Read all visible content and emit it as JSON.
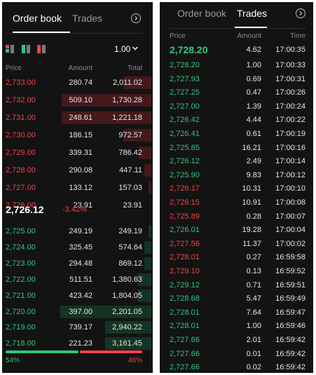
{
  "colors": {
    "buy": "#2fc77a",
    "sell": "#f0424a",
    "background": "#131313"
  },
  "left": {
    "tabs": [
      {
        "label": "Order book",
        "active": true
      },
      {
        "label": "Trades",
        "active": false
      }
    ],
    "forward_icon": "chevron-right-circle-icon",
    "aggregation": "1.00",
    "headers": {
      "price": "Price",
      "amount": "Amount",
      "total": "Total"
    },
    "asks": [
      {
        "price": "2,733.00",
        "amount": "280.74",
        "total": "2,011.02",
        "depth": 0.2
      },
      {
        "price": "2,732.00",
        "amount": "509.10",
        "total": "1,730.28",
        "depth": 0.64
      },
      {
        "price": "2,731.00",
        "amount": "248.61",
        "total": "1,221.18",
        "depth": 0.64
      },
      {
        "price": "2,730.00",
        "amount": "186.15",
        "total": "972.57",
        "depth": 0.2
      },
      {
        "price": "2,729.00",
        "amount": "339.31",
        "total": "786.42",
        "depth": 0.09
      },
      {
        "price": "2,728.00",
        "amount": "290.08",
        "total": "447.11",
        "depth": 0.05
      },
      {
        "price": "2,727.00",
        "amount": "133.12",
        "total": "157.03",
        "depth": 0.02
      },
      {
        "price": "2,726.00",
        "amount": "23.91",
        "total": "23.91",
        "depth": 0.0
      }
    ],
    "last_price": "2,726.12",
    "change": "-3.42%",
    "bids": [
      {
        "price": "2,725.00",
        "amount": "249.19",
        "total": "249.19",
        "depth": 0.02
      },
      {
        "price": "2,724.00",
        "amount": "325.45",
        "total": "574.64",
        "depth": 0.05
      },
      {
        "price": "2,723.00",
        "amount": "294.48",
        "total": "869.12",
        "depth": 0.05
      },
      {
        "price": "2,722.00",
        "amount": "511.51",
        "total": "1,380.63",
        "depth": 0.1
      },
      {
        "price": "2,721.00",
        "amount": "423.42",
        "total": "1,804.05",
        "depth": 0.1
      },
      {
        "price": "2,720.00",
        "amount": "397.00",
        "total": "2,201.05",
        "depth": 0.65
      },
      {
        "price": "2,719.00",
        "amount": "739.17",
        "total": "2,940.22",
        "depth": 0.33
      },
      {
        "price": "2,718.00",
        "amount": "221.23",
        "total": "3,161.45",
        "depth": 0.33
      }
    ],
    "buy_ratio": {
      "label": "54%",
      "value": 54
    },
    "sell_ratio": {
      "label": "46%",
      "value": 46
    }
  },
  "right": {
    "tabs": [
      {
        "label": "Order book",
        "active": false
      },
      {
        "label": "Trades",
        "active": true
      }
    ],
    "forward_icon": "chevron-right-circle-icon",
    "headers": {
      "price": "Price",
      "amount": "Amount",
      "time": "Time"
    },
    "trades": [
      {
        "price": "2,728.20",
        "amount": "4.62",
        "time": "17:00:35",
        "side": "buy"
      },
      {
        "price": "2,728.20",
        "amount": "1.00",
        "time": "17:00:33",
        "side": "buy"
      },
      {
        "price": "2,727.93",
        "amount": "0.69",
        "time": "17:00:31",
        "side": "buy"
      },
      {
        "price": "2,727.25",
        "amount": "0.47",
        "time": "17:00:26",
        "side": "buy"
      },
      {
        "price": "2,727.00",
        "amount": "1.39",
        "time": "17:00:24",
        "side": "buy"
      },
      {
        "price": "2,726.42",
        "amount": "4.44",
        "time": "17:00:22",
        "side": "buy"
      },
      {
        "price": "2,726.41",
        "amount": "0.61",
        "time": "17:00:19",
        "side": "buy"
      },
      {
        "price": "2,725.85",
        "amount": "16.21",
        "time": "17:00:16",
        "side": "buy"
      },
      {
        "price": "2,726.12",
        "amount": "2.49",
        "time": "17:00:14",
        "side": "buy"
      },
      {
        "price": "2,725.90",
        "amount": "9.83",
        "time": "17:00:12",
        "side": "buy"
      },
      {
        "price": "2,726.17",
        "amount": "10.31",
        "time": "17:00:10",
        "side": "sell"
      },
      {
        "price": "2,726.15",
        "amount": "10.91",
        "time": "17:00:08",
        "side": "sell"
      },
      {
        "price": "2,725.89",
        "amount": "0.28",
        "time": "17:00:07",
        "side": "sell"
      },
      {
        "price": "2,726.01",
        "amount": "19.28",
        "time": "17:00:04",
        "side": "buy"
      },
      {
        "price": "2,727.56",
        "amount": "11.37",
        "time": "17:00:02",
        "side": "sell"
      },
      {
        "price": "2,728.01",
        "amount": "0.27",
        "time": "16:59:58",
        "side": "sell"
      },
      {
        "price": "2,729.10",
        "amount": "0.13",
        "time": "16:59:52",
        "side": "sell"
      },
      {
        "price": "2,729.12",
        "amount": "0.71",
        "time": "16:59:51",
        "side": "buy"
      },
      {
        "price": "2,728.68",
        "amount": "5.47",
        "time": "16:59:49",
        "side": "buy"
      },
      {
        "price": "2,728.01",
        "amount": "7.64",
        "time": "16:59:47",
        "side": "buy"
      },
      {
        "price": "2,728.01",
        "amount": "1.00",
        "time": "16:59:46",
        "side": "buy"
      },
      {
        "price": "2,727.66",
        "amount": "2.01",
        "time": "16:59:42",
        "side": "buy"
      },
      {
        "price": "2,727.66",
        "amount": "0.01",
        "time": "16:59:42",
        "side": "buy"
      },
      {
        "price": "2,727.66",
        "amount": "0.02",
        "time": "16:59:42",
        "side": "buy"
      }
    ]
  }
}
